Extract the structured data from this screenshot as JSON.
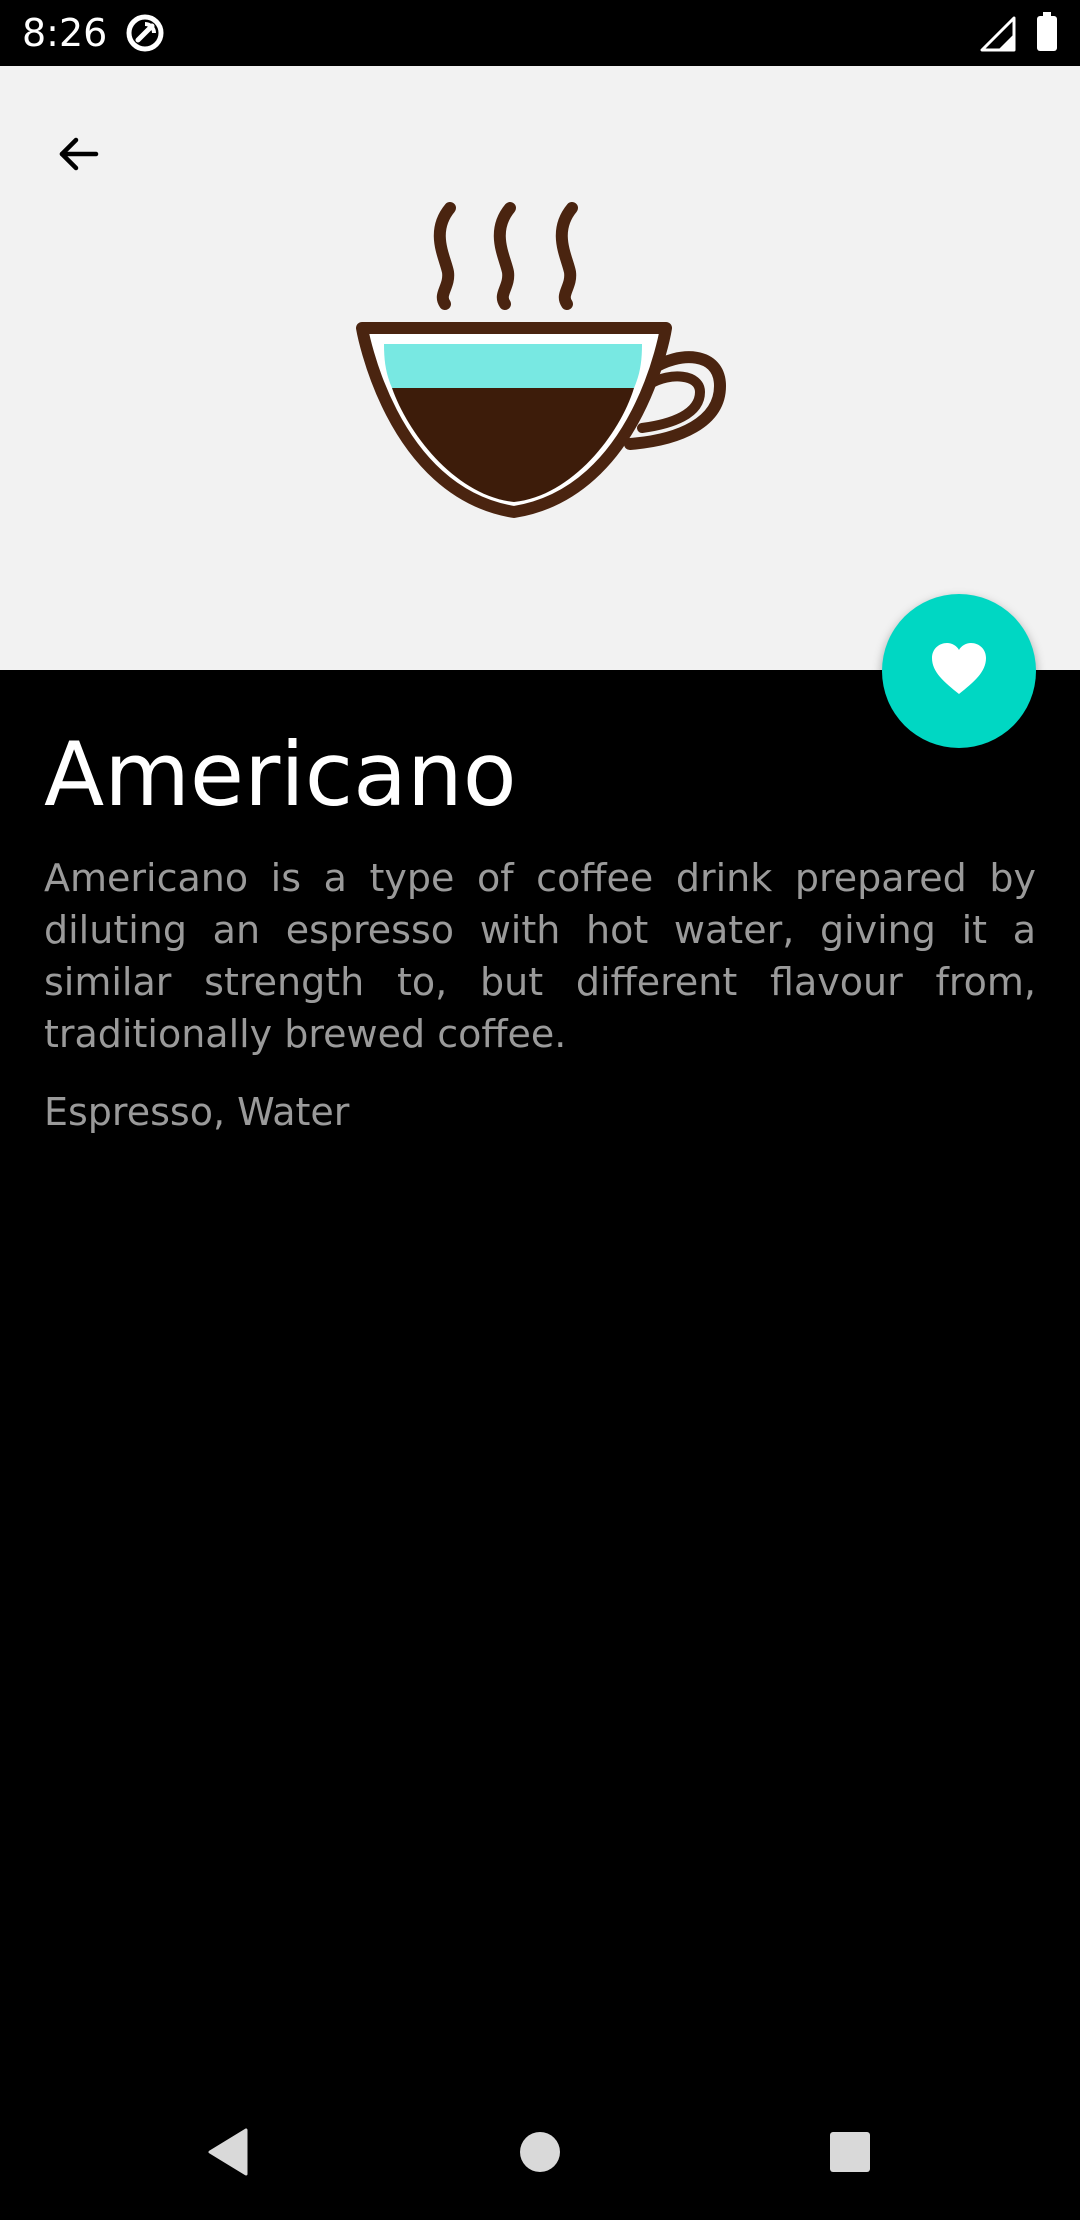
{
  "status_bar": {
    "time": "8:26",
    "icons": [
      "data-saver-icon",
      "cell-signal-icon",
      "battery-icon"
    ]
  },
  "header": {
    "back_icon": "back-arrow-icon",
    "illustration": "coffee-cup-icon",
    "background_color": "#f2f2f2"
  },
  "favorite": {
    "icon": "heart-icon",
    "color": "#00d7c3"
  },
  "drink": {
    "title": "Americano",
    "description": "Americano is a type of coffee drink prepared by diluting an espresso with hot water, giving it a similar strength to, but different flavour from, traditionally brewed coffee.",
    "ingredients": "Espresso, Water"
  },
  "nav_bar": {
    "icons": [
      "nav-back-icon",
      "nav-home-icon",
      "nav-recents-icon"
    ]
  }
}
